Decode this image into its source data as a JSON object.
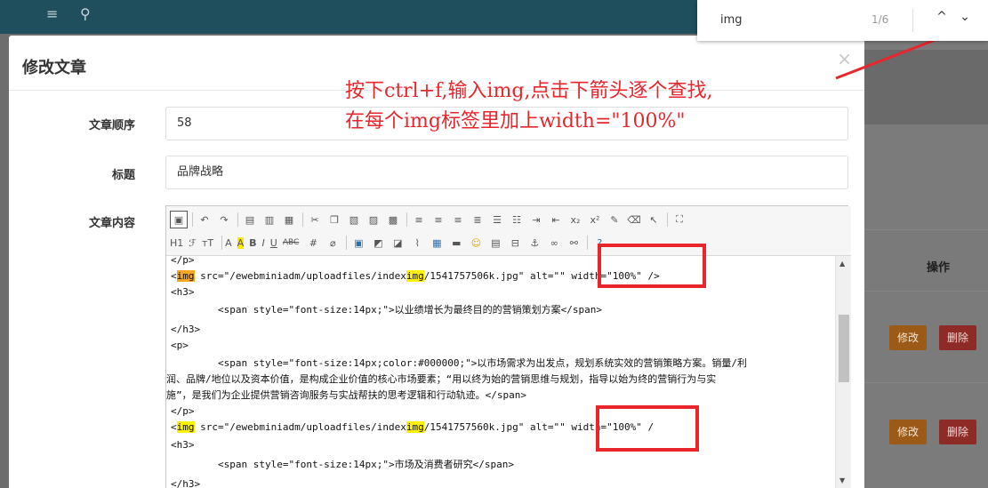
{
  "background": {
    "table_header_op": "操作",
    "row_actions": [
      {
        "edit": "修改",
        "delete": "删除"
      },
      {
        "edit": "修改",
        "delete": "删除"
      }
    ]
  },
  "modal": {
    "title": "修改文章",
    "close": "×",
    "fields": {
      "order_label": "文章顺序",
      "order_value": "58",
      "title_label": "标题",
      "title_value": "品牌战略",
      "content_label": "文章内容"
    }
  },
  "editor": {
    "toolbar_row2": [
      "H1",
      "ℱ",
      "тT",
      "A",
      "A",
      "B",
      "I",
      "U",
      "ABC"
    ],
    "code_lines": {
      "l0": "</p>",
      "l1_pre": "<",
      "l1_img": "img",
      "l1_mid": " src=\"/ewebminiadm/uploadfiles/index",
      "l1_img2": "img",
      "l1_post": "/1541757506k.jpg\" alt=\"\" width=\"100%\" />",
      "l2": "<h3>",
      "l3": "        <span style=\"font-size:14px;\">以业绩增长为最终目的的营销策划方案</span>",
      "l4": "</h3>",
      "l5": "<p>",
      "l6": "        <span style=\"font-size:14px;color:#000000;\">以市场需求为出发点，规划系统实效的营销策略方案。销量/利",
      "l7": "润、品牌/地位以及资本价值，是构成企业价值的核心市场要素；“用以终为始的营销思维与规划，指导以始为终的营销行为与实",
      "l8": "施”，是我们为企业提供营销咨询服务与实战帮扶的思考逻辑和行动轨迹。</span>",
      "l9": "</p>",
      "l10_pre": "<",
      "l10_img": "img",
      "l10_mid": " src=\"/ewebminiadm/uploadfiles/index",
      "l10_img2": "img",
      "l10_post": "/1541757560k.jpg\" alt=\"\" width=\"100%\" /",
      "l11": "<h3>",
      "l12": "        <span style=\"font-size:14px;\">市场及消费者研究</span>",
      "l13": "</h3>"
    }
  },
  "annotation": {
    "line1": "按下ctrl+f,输入img,点击下箭头逐个查找,",
    "line2": "在每个img标签里加上width=\"100%\"",
    "color": "#e8262c"
  },
  "findbar": {
    "query": "img",
    "count": "1/6",
    "up": "^",
    "down": "⌄"
  }
}
